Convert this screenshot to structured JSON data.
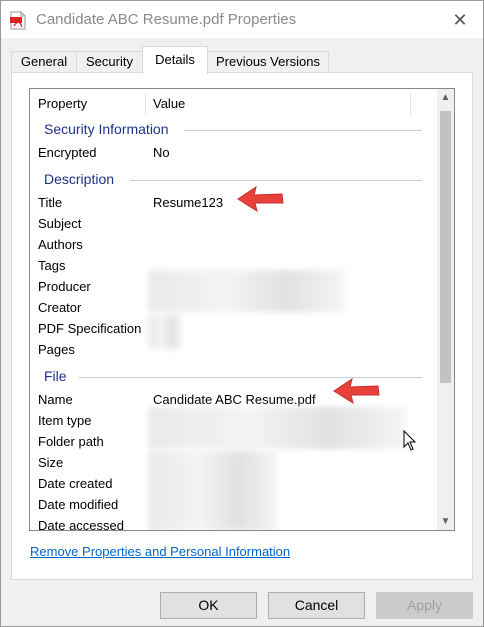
{
  "window": {
    "title": "Candidate ABC Resume.pdf Properties",
    "close_glyph": "✕"
  },
  "tabs": [
    {
      "label": "General"
    },
    {
      "label": "Security"
    },
    {
      "label": "Details"
    },
    {
      "label": "Previous Versions"
    }
  ],
  "active_tab": "Details",
  "list": {
    "columns": {
      "property": "Property",
      "value": "Value"
    },
    "groups": {
      "security": "Security Information",
      "description": "Description",
      "file": "File"
    },
    "security_rows": [
      {
        "label": "Encrypted",
        "value": "No"
      }
    ],
    "description_rows": [
      {
        "label": "Title",
        "value": "Resume123"
      },
      {
        "label": "Subject",
        "value": ""
      },
      {
        "label": "Authors",
        "value": ""
      },
      {
        "label": "Tags",
        "value": ""
      },
      {
        "label": "Producer",
        "value": ""
      },
      {
        "label": "Creator",
        "value": ""
      },
      {
        "label": "PDF Specification",
        "value": ""
      },
      {
        "label": "Pages",
        "value": ""
      }
    ],
    "file_rows": [
      {
        "label": "Name",
        "value": "Candidate ABC Resume.pdf"
      },
      {
        "label": "Item type",
        "value": ""
      },
      {
        "label": "Folder path",
        "value": ""
      },
      {
        "label": "Size",
        "value": ""
      },
      {
        "label": "Date created",
        "value": ""
      },
      {
        "label": "Date modified",
        "value": ""
      },
      {
        "label": "Date accessed",
        "value": ""
      }
    ]
  },
  "remove_link": "Remove Properties and Personal Information",
  "buttons": {
    "ok": "OK",
    "cancel": "Cancel",
    "apply": "Apply"
  },
  "colors": {
    "link": "#0066cc",
    "group_header": "#1e3287",
    "annotation_arrow": "#e8413c"
  },
  "icons": {
    "title": "pdf-file-icon",
    "close": "close-icon",
    "scroll_up": "scroll-up-arrow-icon",
    "scroll_down": "scroll-down-arrow-icon",
    "cursor": "mouse-pointer-icon",
    "annotation": "red-arrow-icon"
  }
}
